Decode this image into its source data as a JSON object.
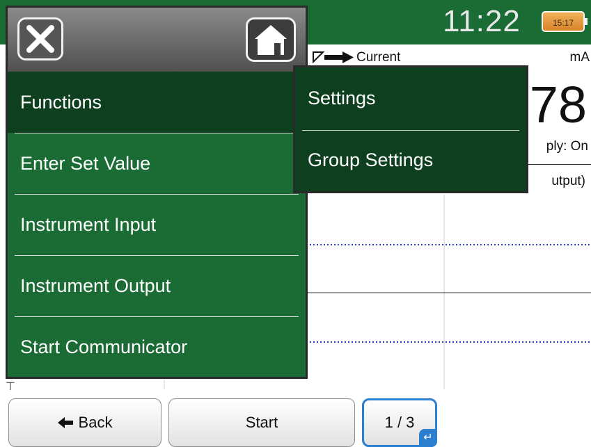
{
  "status_bar": {
    "time": "11:22",
    "battery_label": "15:17"
  },
  "function_panel": {
    "label": "Current",
    "unit": "mA",
    "value_fragment": "78",
    "supply_fragment": "ply: On",
    "output_fragment": "utput)"
  },
  "menu": {
    "close_icon": "close-icon",
    "home_icon": "home-icon",
    "items": [
      {
        "label": "Functions",
        "selected": true
      },
      {
        "label": "Enter Set Value",
        "selected": false
      },
      {
        "label": "Instrument Input",
        "selected": false
      },
      {
        "label": "Instrument Output",
        "selected": false
      },
      {
        "label": "Start Communicator",
        "selected": false
      }
    ]
  },
  "submenu": {
    "items": [
      {
        "label": "Settings"
      },
      {
        "label": "Group Settings"
      }
    ]
  },
  "toolbar": {
    "back_label": "Back",
    "start_label": "Start",
    "page_label": "1 / 3"
  },
  "colors": {
    "menu_green": "#1b6b35",
    "selected_green": "#0e3f1f",
    "accent_blue": "#2a7fd0"
  }
}
